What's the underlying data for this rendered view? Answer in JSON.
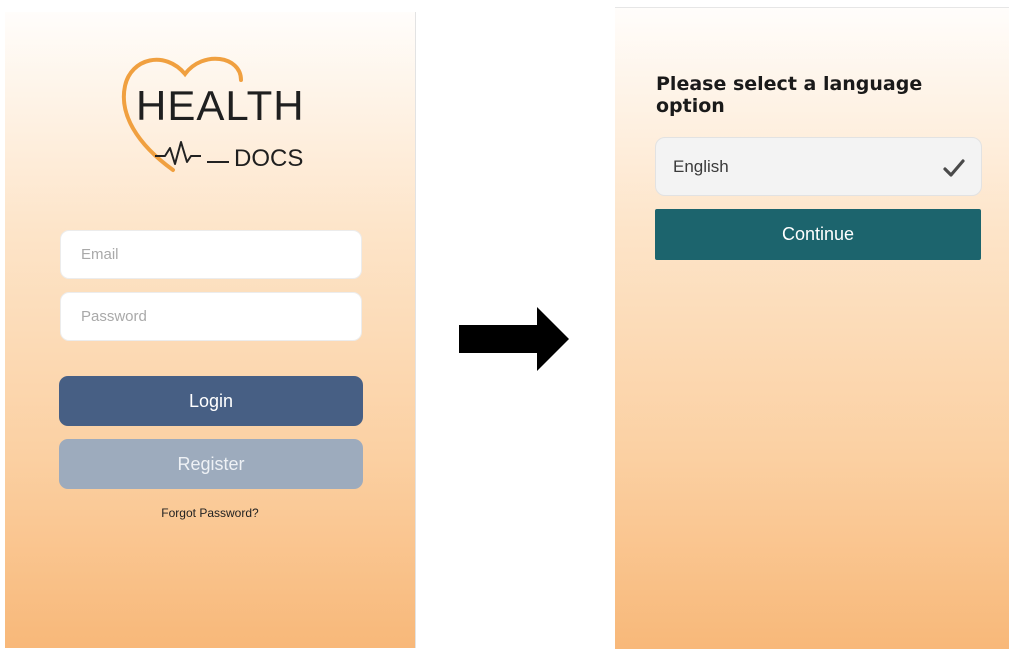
{
  "login_screen": {
    "logo": {
      "word1": "HEALTH",
      "word2": "DOCS",
      "heart_color": "#f0a040",
      "text_color": "#1f1f1f"
    },
    "email_placeholder": "Email",
    "password_placeholder": "Password",
    "login_label": "Login",
    "register_label": "Register",
    "forgot_label": "Forgot Password?"
  },
  "arrow": {
    "icon": "right-arrow-icon",
    "color": "#000000"
  },
  "language_screen": {
    "title": "Please select a language option",
    "option_label": "English",
    "option_icon": "checkmark-icon",
    "continue_label": "Continue"
  },
  "colors": {
    "login_button": "#475f84",
    "register_button": "#9dabbd",
    "continue_button": "#1c646d",
    "gradient_top": "#fffdfb",
    "gradient_bottom": "#f8b879"
  }
}
